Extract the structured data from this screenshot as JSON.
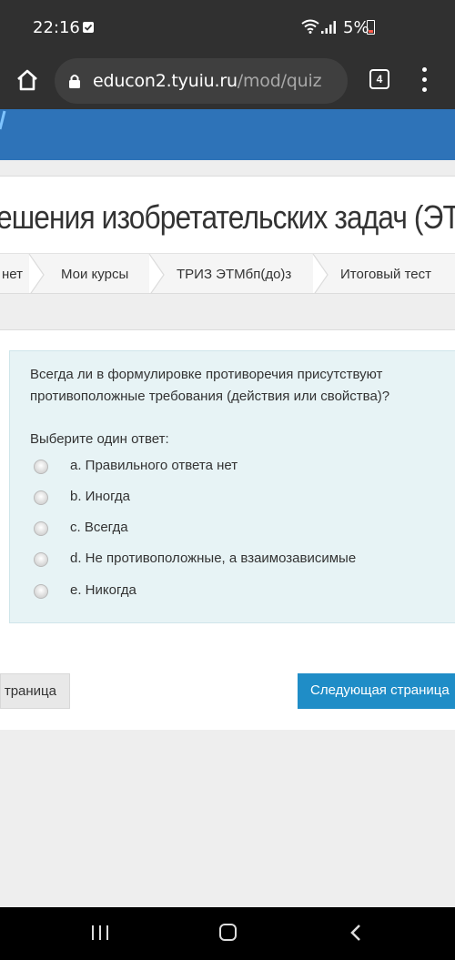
{
  "status_bar": {
    "time": "22:16",
    "battery_percent": "5%",
    "icons": [
      "notification-check-icon",
      "wifi-icon",
      "signal-icon",
      "battery-low-icon"
    ],
    "battery_color": "#ff5a4a"
  },
  "browser": {
    "url_host": "educon2.tyuiu.ru",
    "url_path": "/mod/quiz",
    "tab_count": "4"
  },
  "header": {
    "course_title": "ешения изобретательских задач (ЭТ",
    "accent_color": "#2e73b8"
  },
  "breadcrumb": {
    "items": [
      "нет",
      "Мои курсы",
      "ТРИЗ ЭТМбп(до)з",
      "Итоговый тест"
    ]
  },
  "question": {
    "text": "Всегда ли в формулировке противоречия присутствуют противоположные требования (действия или свойства)?",
    "prompt": "Выберите один ответ:",
    "answers": [
      {
        "label": "a. Правильного ответа нет"
      },
      {
        "label": "b. Иногда"
      },
      {
        "label": "c. Всегда"
      },
      {
        "label": "d. Не противоположные, а взаимозависимые"
      },
      {
        "label": "e. Никогда"
      }
    ]
  },
  "navigation": {
    "prev_label": "траница",
    "next_label": "Следующая страница",
    "next_color": "#1f8dc7"
  }
}
